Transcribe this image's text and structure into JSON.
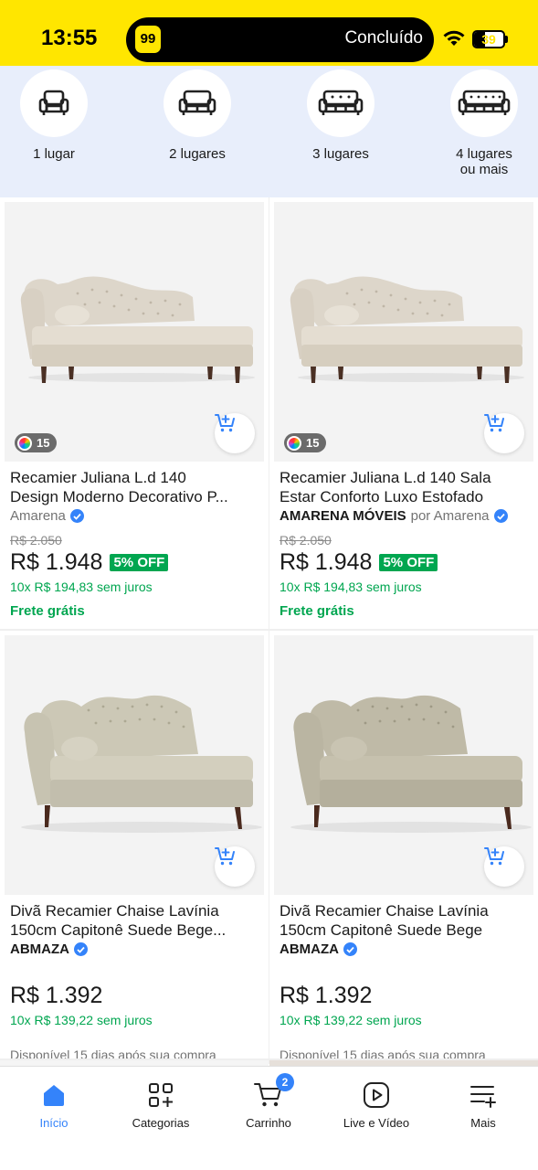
{
  "status_bar": {
    "time": "13:55",
    "app_badge": "99",
    "done_label": "Concluído",
    "battery": "39"
  },
  "categories": [
    {
      "label": "1 lugar",
      "icon": "armchair-icon"
    },
    {
      "label": "2 lugares",
      "icon": "loveseat-icon"
    },
    {
      "label": "3 lugares",
      "icon": "sofa-icon"
    },
    {
      "label": "4 lugares ou mais",
      "icon": "large-sofa-icon"
    }
  ],
  "products": [
    {
      "title_line1": "Recamier Juliana L.d 140",
      "title_line2": "Design Moderno Decorativo P...",
      "seller_name": "Amarena",
      "old_price": "R$ 2.050",
      "price": "R$ 1.948",
      "discount": "5% OFF",
      "installments": "10x R$ 194,83 sem juros",
      "shipping": "Frete grátis",
      "color_count": "15"
    },
    {
      "title_line1": "Recamier Juliana L.d 140 Sala",
      "title_line2": "Estar Conforto Luxo Estofado",
      "seller_name": "AMARENA MÓVEIS",
      "seller_por": "por Amarena",
      "old_price": "R$ 2.050",
      "price": "R$ 1.948",
      "discount": "5% OFF",
      "installments": "10x R$ 194,83 sem juros",
      "shipping": "Frete grátis",
      "color_count": "15"
    },
    {
      "title_line1": "Divã Recamier Chaise Lavínia",
      "title_line2": "150cm Capitonê Suede Bege...",
      "seller_name": "ABMAZA",
      "price": "R$ 1.392",
      "installments": "10x R$ 139,22 sem juros",
      "availability": "Disponível 15 dias após sua compra"
    },
    {
      "title_line1": "Divã Recamier Chaise Lavínia",
      "title_line2": "150cm Capitonê Suede Bege",
      "seller_name": "ABMAZA",
      "price": "R$ 1.392",
      "installments": "10x R$ 139,22 sem juros",
      "availability": "Disponível 15 dias após sua compra"
    }
  ],
  "bottom_nav": [
    {
      "label": "Início",
      "icon": "home-icon",
      "active": true
    },
    {
      "label": "Categorias",
      "icon": "categories-icon"
    },
    {
      "label": "Carrinho",
      "icon": "cart-icon",
      "badge": "2"
    },
    {
      "label": "Live e Vídeo",
      "icon": "play-icon"
    },
    {
      "label": "Mais",
      "icon": "menu-plus-icon"
    }
  ],
  "colors": {
    "brand_yellow": "#ffe600",
    "category_bg": "#e8eefb",
    "accent_blue": "#3483fa",
    "green": "#00a650"
  }
}
